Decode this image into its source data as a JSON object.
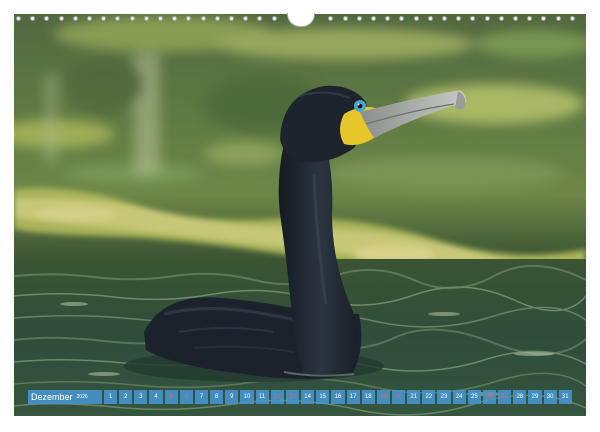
{
  "calendar": {
    "month": "Dezember",
    "year": "2026",
    "days": [
      "1",
      "2",
      "3",
      "4",
      "5",
      "6",
      "7",
      "8",
      "9",
      "10",
      "11",
      "12",
      "13",
      "14",
      "15",
      "16",
      "17",
      "18",
      "19",
      "20",
      "21",
      "22",
      "23",
      "24",
      "25",
      "26",
      "27",
      "28",
      "29",
      "30",
      "31"
    ],
    "weekend_days": [
      "5",
      "6",
      "12",
      "13",
      "19",
      "20",
      "26",
      "27"
    ]
  },
  "photo": {
    "subject": "cormorant-swimming",
    "colors": {
      "water": "#3d5a3c",
      "foliage": "#9fae55",
      "bird": "#1f2630",
      "beak_patch": "#e6c62a",
      "eye": "#4aa6c9"
    }
  },
  "binding": {
    "holes": 40
  }
}
